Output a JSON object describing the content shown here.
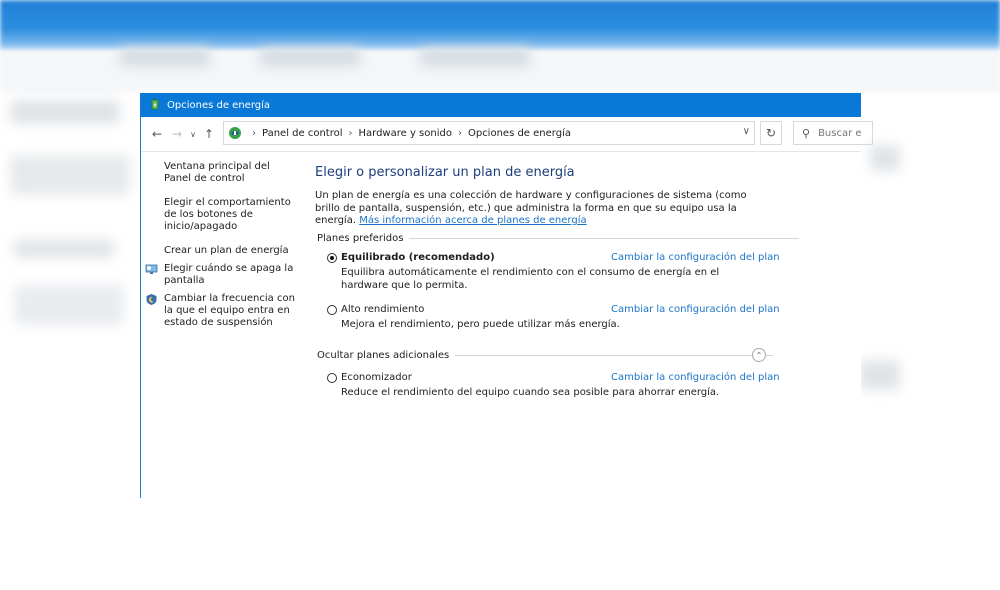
{
  "window": {
    "title": "Opciones de energía",
    "title_icon": "power-options-icon"
  },
  "navigation": {
    "back_icon": "arrow-left-icon",
    "forward_icon": "arrow-right-icon",
    "recent_icon": "chevron-down-icon",
    "up_icon": "arrow-up-icon"
  },
  "address_bar": {
    "breadcrumbs": [
      "Panel de control",
      "Hardware y sonido",
      "Opciones de energía"
    ],
    "refresh_icon": "refresh-icon"
  },
  "search": {
    "placeholder": "Buscar e"
  },
  "sidebar": {
    "items": [
      {
        "label": "Ventana principal del Panel de control"
      },
      {
        "label": "Elegir el comportamiento de los botones de inicio/apagado"
      },
      {
        "label": "Crear un plan de energía"
      },
      {
        "label": "Elegir cuándo se apaga la pantalla",
        "icon": "display-icon"
      },
      {
        "label": "Cambiar la frecuencia con la que el equipo entra en estado de suspensión",
        "icon": "moon-shield-icon"
      }
    ]
  },
  "main": {
    "heading": "Elegir o personalizar un plan de energía",
    "description": "Un plan de energía es una colección de hardware y configuraciones de sistema (como brillo de pantalla, suspensión, etc.) que administra la forma en que su equipo usa la energía.",
    "more_info_link": "Más información acerca de planes de energía",
    "preferred_section": "Planes preferidos",
    "hidden_section": "Ocultar planes adicionales",
    "change_link": "Cambiar la configuración del plan",
    "plans": [
      {
        "name": "Equilibrado (recomendado)",
        "description": "Equilibra automáticamente el rendimiento con el consumo de energía en el hardware que lo permita.",
        "selected": true
      },
      {
        "name": "Alto rendimiento",
        "description": "Mejora el rendimiento, pero puede utilizar más energía.",
        "selected": false
      },
      {
        "name": "Economizador",
        "description": "Reduce el rendimiento del equipo cuando sea posible para ahorrar energía.",
        "selected": false
      }
    ]
  },
  "colors": {
    "titlebar": "#0a78d7",
    "heading": "#1c3e7a",
    "link": "#1a73c9"
  }
}
